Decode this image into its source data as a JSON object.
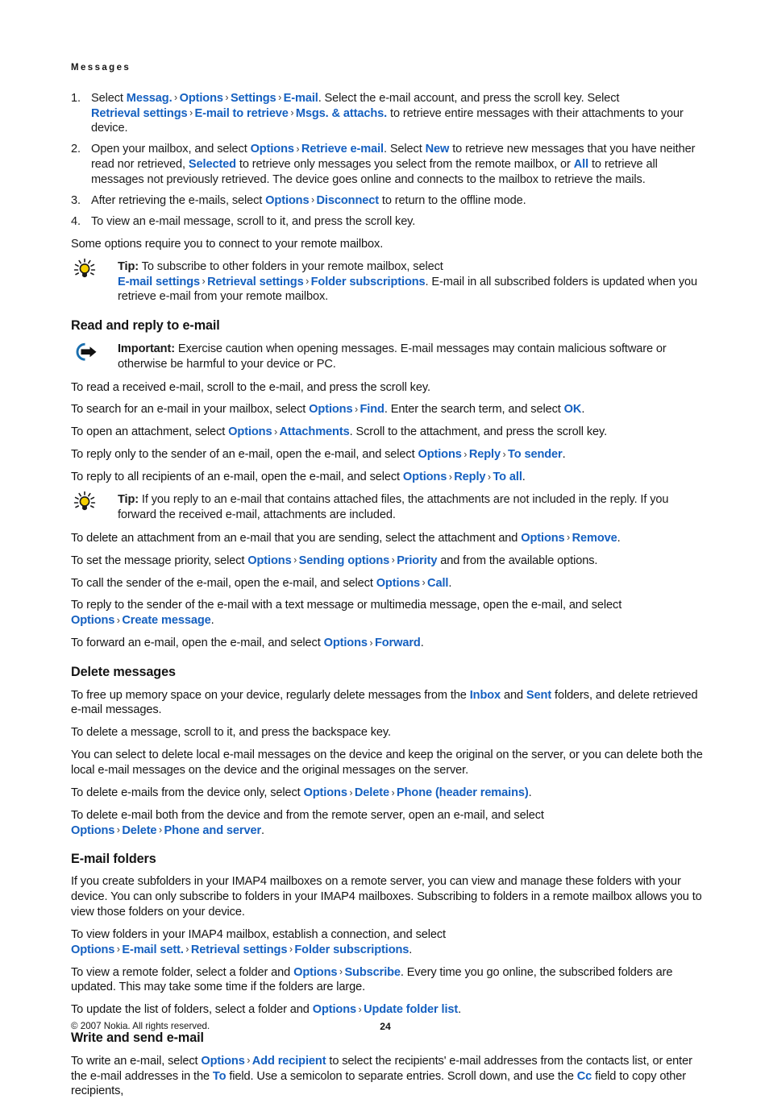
{
  "document": {
    "running_head": "Messages",
    "page_number": "24",
    "copyright": "© 2007 Nokia. All rights reserved.",
    "link_color": "#1560c0",
    "text_color": "#141414"
  },
  "steps": [
    {
      "num": "1.",
      "segments": [
        {
          "t": "Select ",
          "k": "text"
        },
        {
          "t": "Messag.",
          "k": "link"
        },
        {
          "t": ">",
          "k": "chev"
        },
        {
          "t": "Options",
          "k": "link"
        },
        {
          "t": ">",
          "k": "chev"
        },
        {
          "t": "Settings",
          "k": "link"
        },
        {
          "t": ">",
          "k": "chev"
        },
        {
          "t": "E-mail",
          "k": "link"
        },
        {
          "t": ". Select the e-mail account, and press the scroll key. Select ",
          "k": "text"
        },
        {
          "t": "Retrieval settings",
          "k": "link"
        },
        {
          "t": ">",
          "k": "chev"
        },
        {
          "t": "E-mail to retrieve",
          "k": "link"
        },
        {
          "t": ">",
          "k": "chev"
        },
        {
          "t": "Msgs. & attachs.",
          "k": "link"
        },
        {
          "t": " to retrieve entire messages with their attachments to your device.",
          "k": "text"
        }
      ]
    },
    {
      "num": "2.",
      "segments": [
        {
          "t": "Open your mailbox, and select ",
          "k": "text"
        },
        {
          "t": "Options",
          "k": "link"
        },
        {
          "t": ">",
          "k": "chev"
        },
        {
          "t": "Retrieve e-mail",
          "k": "link"
        },
        {
          "t": ". Select ",
          "k": "text"
        },
        {
          "t": "New",
          "k": "link"
        },
        {
          "t": " to retrieve new messages that you have neither read nor retrieved, ",
          "k": "text"
        },
        {
          "t": "Selected",
          "k": "link"
        },
        {
          "t": " to retrieve only messages you select from the remote mailbox, or ",
          "k": "text"
        },
        {
          "t": "All",
          "k": "link"
        },
        {
          "t": " to retrieve all messages not previously retrieved. The device goes online and connects to the mailbox to retrieve the mails.",
          "k": "text"
        }
      ]
    },
    {
      "num": "3.",
      "segments": [
        {
          "t": "After retrieving the e-mails, select ",
          "k": "text"
        },
        {
          "t": "Options",
          "k": "link"
        },
        {
          "t": ">",
          "k": "chev"
        },
        {
          "t": "Disconnect",
          "k": "link"
        },
        {
          "t": " to return to the offline mode.",
          "k": "text"
        }
      ]
    },
    {
      "num": "4.",
      "segments": [
        {
          "t": "To view an e-mail message, scroll to it, and press the scroll key.",
          "k": "text"
        }
      ]
    }
  ],
  "para_some_options": [
    {
      "t": "Some options require you to connect to your remote mailbox.",
      "k": "text"
    }
  ],
  "tip_subscribe": {
    "icon": "lightbulb-icon",
    "segments": [
      {
        "t": "Tip:",
        "k": "bold"
      },
      {
        "t": " To subscribe to other folders in your remote mailbox, select ",
        "k": "text"
      },
      {
        "t": "E-mail settings",
        "k": "link"
      },
      {
        "t": ">",
        "k": "chev"
      },
      {
        "t": "Retrieval settings",
        "k": "link"
      },
      {
        "t": ">",
        "k": "chev"
      },
      {
        "t": "Folder subscriptions",
        "k": "link"
      },
      {
        "t": ". E-mail in all subscribed folders is updated when you retrieve e-mail from your remote mailbox.",
        "k": "text"
      }
    ]
  },
  "section_read_reply": {
    "heading": "Read and reply to e-mail",
    "important": {
      "icon": "important-arrow-icon",
      "segments": [
        {
          "t": "Important:",
          "k": "bold"
        },
        {
          "t": "  Exercise caution when opening messages. E-mail messages may contain malicious software or otherwise be harmful to your device or PC.",
          "k": "text"
        }
      ]
    },
    "paragraphs": [
      [
        {
          "t": "To read a received e-mail, scroll to the e-mail, and press the scroll key.",
          "k": "text"
        }
      ],
      [
        {
          "t": "To search for an e-mail in your mailbox, select ",
          "k": "text"
        },
        {
          "t": "Options",
          "k": "link"
        },
        {
          "t": ">",
          "k": "chev"
        },
        {
          "t": "Find",
          "k": "link"
        },
        {
          "t": ". Enter the search term, and select ",
          "k": "text"
        },
        {
          "t": "OK",
          "k": "link"
        },
        {
          "t": ".",
          "k": "text"
        }
      ],
      [
        {
          "t": "To open an attachment, select ",
          "k": "text"
        },
        {
          "t": "Options",
          "k": "link"
        },
        {
          "t": ">",
          "k": "chev"
        },
        {
          "t": "Attachments",
          "k": "link"
        },
        {
          "t": ". Scroll to the attachment, and press the scroll key.",
          "k": "text"
        }
      ],
      [
        {
          "t": "To reply only to the sender of an e-mail, open the e-mail, and select ",
          "k": "text"
        },
        {
          "t": "Options",
          "k": "link"
        },
        {
          "t": ">",
          "k": "chev"
        },
        {
          "t": "Reply",
          "k": "link"
        },
        {
          "t": ">",
          "k": "chev"
        },
        {
          "t": "To sender",
          "k": "link"
        },
        {
          "t": ".",
          "k": "text"
        }
      ],
      [
        {
          "t": "To reply to all recipients of an e-mail, open the e-mail, and select ",
          "k": "text"
        },
        {
          "t": "Options",
          "k": "link"
        },
        {
          "t": ">",
          "k": "chev"
        },
        {
          "t": "Reply",
          "k": "link"
        },
        {
          "t": ">",
          "k": "chev"
        },
        {
          "t": "To all",
          "k": "link"
        },
        {
          "t": ".",
          "k": "text"
        }
      ]
    ],
    "tip_attachments": {
      "icon": "lightbulb-icon",
      "segments": [
        {
          "t": "Tip:",
          "k": "bold"
        },
        {
          "t": " If you reply to an e-mail that contains attached files, the attachments are not included in the reply. If you forward the received e-mail, attachments are included.",
          "k": "text"
        }
      ]
    },
    "paragraphs_after": [
      [
        {
          "t": "To delete an attachment from an e-mail that you are sending, select the attachment and ",
          "k": "text"
        },
        {
          "t": "Options",
          "k": "link"
        },
        {
          "t": ">",
          "k": "chev"
        },
        {
          "t": "Remove",
          "k": "link"
        },
        {
          "t": ".",
          "k": "text"
        }
      ],
      [
        {
          "t": "To set the message priority, select ",
          "k": "text"
        },
        {
          "t": "Options",
          "k": "link"
        },
        {
          "t": ">",
          "k": "chev"
        },
        {
          "t": "Sending options",
          "k": "link"
        },
        {
          "t": ">",
          "k": "chev"
        },
        {
          "t": "Priority",
          "k": "link"
        },
        {
          "t": " and from the available options.",
          "k": "text"
        }
      ],
      [
        {
          "t": "To call the sender of the e-mail, open the e-mail, and select ",
          "k": "text"
        },
        {
          "t": "Options",
          "k": "link"
        },
        {
          "t": ">",
          "k": "chev"
        },
        {
          "t": "Call",
          "k": "link"
        },
        {
          "t": ".",
          "k": "text"
        }
      ],
      [
        {
          "t": "To reply to the sender of the e-mail with a text message or multimedia message, open the e-mail, and select ",
          "k": "text"
        },
        {
          "t": "Options",
          "k": "link"
        },
        {
          "t": ">",
          "k": "chev"
        },
        {
          "t": "Create message",
          "k": "link"
        },
        {
          "t": ".",
          "k": "text"
        }
      ],
      [
        {
          "t": "To forward an e-mail, open the e-mail, and select ",
          "k": "text"
        },
        {
          "t": "Options",
          "k": "link"
        },
        {
          "t": ">",
          "k": "chev"
        },
        {
          "t": "Forward",
          "k": "link"
        },
        {
          "t": ".",
          "k": "text"
        }
      ]
    ]
  },
  "section_delete": {
    "heading": "Delete messages",
    "paragraphs": [
      [
        {
          "t": "To free up memory space on your device, regularly delete messages from the ",
          "k": "text"
        },
        {
          "t": "Inbox",
          "k": "link"
        },
        {
          "t": " and ",
          "k": "text"
        },
        {
          "t": "Sent",
          "k": "link"
        },
        {
          "t": " folders, and delete retrieved e-mail messages.",
          "k": "text"
        }
      ],
      [
        {
          "t": "To delete a message, scroll to it, and press the backspace key.",
          "k": "text"
        }
      ],
      [
        {
          "t": "You can select to delete local e-mail messages on the device and keep the original on the server, or you can delete both the local e-mail messages on the device and the original messages on the server.",
          "k": "text"
        }
      ],
      [
        {
          "t": "To delete e-mails from the device only, select ",
          "k": "text"
        },
        {
          "t": "Options",
          "k": "link"
        },
        {
          "t": ">",
          "k": "chev"
        },
        {
          "t": "Delete",
          "k": "link"
        },
        {
          "t": ">",
          "k": "chev"
        },
        {
          "t": "Phone (header remains)",
          "k": "link"
        },
        {
          "t": ".",
          "k": "text"
        }
      ],
      [
        {
          "t": "To delete e-mail both from the device and from the remote server, open an e-mail, and select ",
          "k": "text"
        },
        {
          "t": "Options",
          "k": "link"
        },
        {
          "t": ">",
          "k": "chev"
        },
        {
          "t": "Delete",
          "k": "link"
        },
        {
          "t": ">",
          "k": "chev"
        },
        {
          "t": "Phone and server",
          "k": "link"
        },
        {
          "t": ".",
          "k": "text"
        }
      ]
    ]
  },
  "section_folders": {
    "heading": "E-mail folders",
    "paragraphs": [
      [
        {
          "t": "If you create subfolders in your IMAP4 mailboxes on a remote server, you can view and manage these folders with your device. You can only subscribe to folders in your IMAP4 mailboxes. Subscribing to folders in a remote mailbox allows you to view those folders on your device.",
          "k": "text"
        }
      ],
      [
        {
          "t": "To view folders in your IMAP4 mailbox, establish a connection, and select ",
          "k": "text"
        },
        {
          "t": "Options",
          "k": "link"
        },
        {
          "t": ">",
          "k": "chev"
        },
        {
          "t": "E-mail sett.",
          "k": "link"
        },
        {
          "t": ">",
          "k": "chev"
        },
        {
          "t": "Retrieval settings",
          "k": "link"
        },
        {
          "t": ">",
          "k": "chev"
        },
        {
          "t": "Folder subscriptions",
          "k": "link"
        },
        {
          "t": ".",
          "k": "text"
        }
      ],
      [
        {
          "t": "To view a remote folder, select a folder and ",
          "k": "text"
        },
        {
          "t": "Options",
          "k": "link"
        },
        {
          "t": ">",
          "k": "chev"
        },
        {
          "t": "Subscribe",
          "k": "link"
        },
        {
          "t": ". Every time you go online, the subscribed folders are updated. This may take some time if the folders are large.",
          "k": "text"
        }
      ],
      [
        {
          "t": "To update the list of folders, select a folder and ",
          "k": "text"
        },
        {
          "t": "Options",
          "k": "link"
        },
        {
          "t": ">",
          "k": "chev"
        },
        {
          "t": "Update folder list",
          "k": "link"
        },
        {
          "t": ".",
          "k": "text"
        }
      ]
    ]
  },
  "section_write": {
    "heading": "Write and send e-mail",
    "paragraphs": [
      [
        {
          "t": "To write an e-mail, select ",
          "k": "text"
        },
        {
          "t": "Options",
          "k": "link"
        },
        {
          "t": ">",
          "k": "chev"
        },
        {
          "t": "Add recipient",
          "k": "link"
        },
        {
          "t": " to select the recipients' e-mail addresses from the contacts list, or enter the e-mail addresses in the ",
          "k": "text"
        },
        {
          "t": "To",
          "k": "link"
        },
        {
          "t": " field. Use a semicolon to separate entries. Scroll down, and use the ",
          "k": "text"
        },
        {
          "t": "Cc",
          "k": "link"
        },
        {
          "t": " field to copy other recipients,",
          "k": "text"
        }
      ]
    ]
  }
}
